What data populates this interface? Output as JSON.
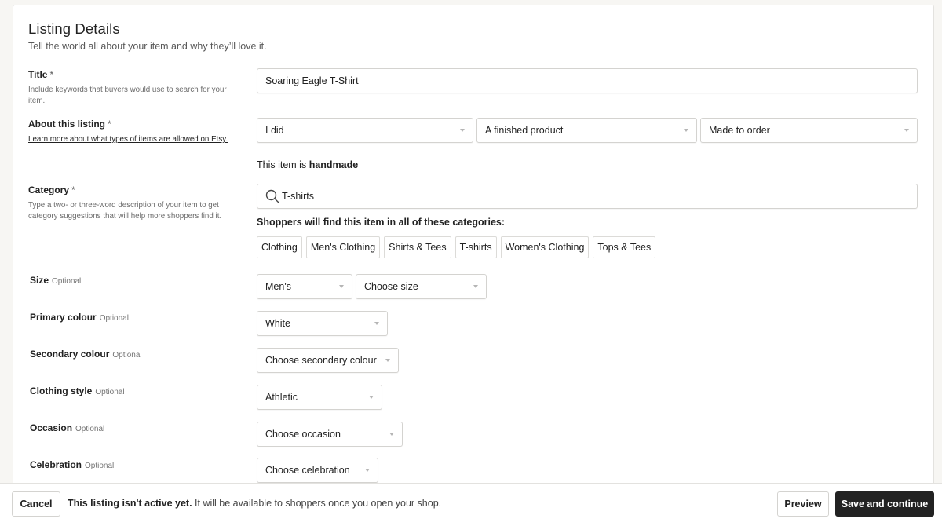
{
  "header": {
    "title": "Listing Details",
    "subtitle": "Tell the world all about your item and why they’ll love it."
  },
  "title_field": {
    "label": "Title",
    "required_mark": "*",
    "description": "Include keywords that buyers would use to search for your item.",
    "value": "Soaring Eagle T-Shirt"
  },
  "about": {
    "label": "About this listing",
    "required_mark": "*",
    "link": "Learn more about what types of items are allowed on Etsy.",
    "who_made": "I did",
    "what_is_it": "A finished product",
    "when_made": "Made to order",
    "note_prefix": "This item is",
    "note_value": "handmade"
  },
  "category": {
    "label": "Category",
    "required_mark": "*",
    "description": "Type a two- or three-word description of your item to get category suggestions that will help more shoppers find it.",
    "search_value": "T-shirts",
    "search_icon": "search-icon",
    "suggestions_heading": "Shoppers will find this item in all of these categories:",
    "chips": [
      "Clothing",
      "Men's Clothing",
      "Shirts & Tees",
      "T-shirts",
      "Women's Clothing",
      "Tops & Tees"
    ]
  },
  "optional_label": "Optional",
  "attributes": {
    "size": {
      "label": "Size",
      "type_value": "Men's",
      "size_value": "Choose size"
    },
    "primary_colour": {
      "label": "Primary colour",
      "value": "White"
    },
    "secondary_colour": {
      "label": "Secondary colour",
      "value": "Choose secondary colour"
    },
    "clothing_style": {
      "label": "Clothing style",
      "value": "Athletic"
    },
    "occasion": {
      "label": "Occasion",
      "value": "Choose occasion"
    },
    "celebration": {
      "label": "Celebration",
      "value": "Choose celebration"
    }
  },
  "footer": {
    "cancel": "Cancel",
    "message_bold": "This listing isn't active yet.",
    "message_rest": " It will be available to shoppers once you open your shop.",
    "preview": "Preview",
    "save": "Save and continue"
  }
}
